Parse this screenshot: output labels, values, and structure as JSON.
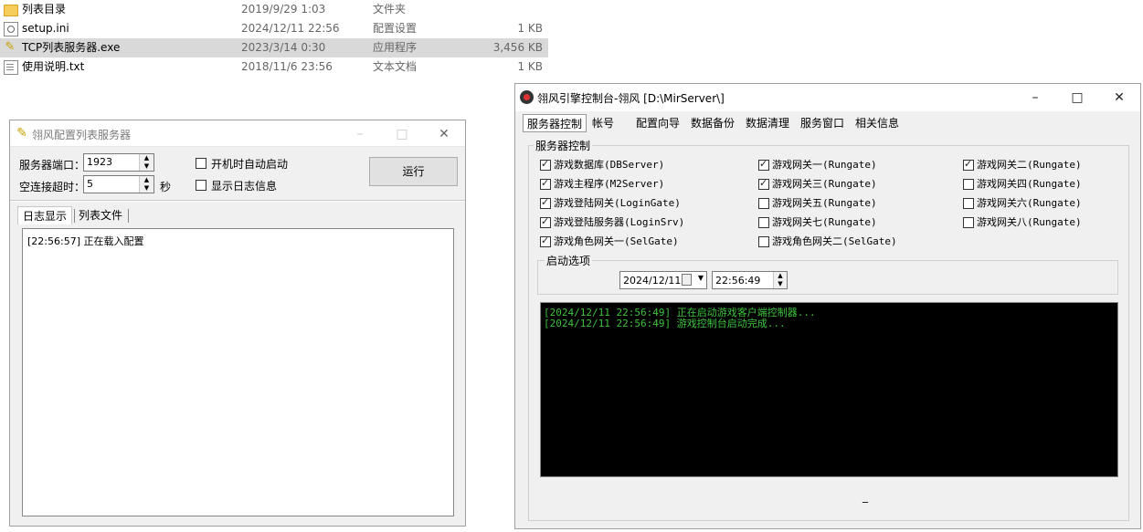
{
  "files": [
    {
      "icon": "folder-icon",
      "name": "列表目录",
      "date": "2019/9/29 1:03",
      "type": "文件夹",
      "size": ""
    },
    {
      "icon": "ini-file-icon",
      "name": "setup.ini",
      "date": "2024/12/11 22:56",
      "type": "配置设置",
      "size": "1 KB"
    },
    {
      "icon": "exe-file-icon",
      "name": "TCP列表服务器.exe",
      "date": "2023/3/14 0:30",
      "type": "应用程序",
      "size": "3,456 KB"
    },
    {
      "icon": "txt-file-icon",
      "name": "使用说明.txt",
      "date": "2018/11/6 23:56",
      "type": "文本文档",
      "size": "1 KB"
    }
  ],
  "win1": {
    "title": "翎风配置列表服务器",
    "port_label": "服务器端口：",
    "port_value": "1923",
    "timeout_label": "空连接超时：",
    "timeout_value": "5",
    "timeout_unit": "秒",
    "autostart_label": "开机时自动启动",
    "showlog_label": "显示日志信息",
    "run_label": "运行",
    "tabs": [
      "日志显示",
      "列表文件"
    ],
    "log": [
      "[22:56:57] 正在载入配置"
    ]
  },
  "win2": {
    "title": "翎风引擎控制台-翎风 [D:\\MirServer\\]",
    "tabs": [
      "服务器控制",
      "帐号",
      "配置向导",
      "数据备份",
      "数据清理",
      "服务窗口",
      "相关信息"
    ],
    "group_title": "服务器控制",
    "services": [
      {
        "label": "游戏数据库(DBServer)",
        "checked": true
      },
      {
        "label": "游戏网关一(Rungate)",
        "checked": true
      },
      {
        "label": "游戏网关二(Rungate)",
        "checked": true
      },
      {
        "label": "游戏主程序(M2Server)",
        "checked": true
      },
      {
        "label": "游戏网关三(Rungate)",
        "checked": true
      },
      {
        "label": "游戏网关四(Rungate)",
        "checked": false
      },
      {
        "label": "游戏登陆网关(LoginGate)",
        "checked": true
      },
      {
        "label": "游戏网关五(Rungate)",
        "checked": false
      },
      {
        "label": "游戏网关六(Rungate)",
        "checked": false
      },
      {
        "label": "游戏登陆服务器(LoginSrv)",
        "checked": true
      },
      {
        "label": "游戏网关七(Rungate)",
        "checked": false
      },
      {
        "label": "游戏网关八(Rungate)",
        "checked": false
      },
      {
        "label": "游戏角色网关一(SelGate)",
        "checked": true
      },
      {
        "label": "游戏角色网关二(SelGate)",
        "checked": false
      }
    ],
    "startup_title": "启动选项",
    "date_value": "2024/12/11",
    "time_value": "22:56:49",
    "console": [
      "[2024/12/11 22:56:49] 正在启动游戏客户端控制器...",
      "[2024/12/11 22:56:49] 游戏控制台启动完成..."
    ],
    "status": "_"
  },
  "colors": {
    "console_text": "#3ec23e",
    "console_bg": "#000000",
    "selection": "#d9d9d9"
  }
}
